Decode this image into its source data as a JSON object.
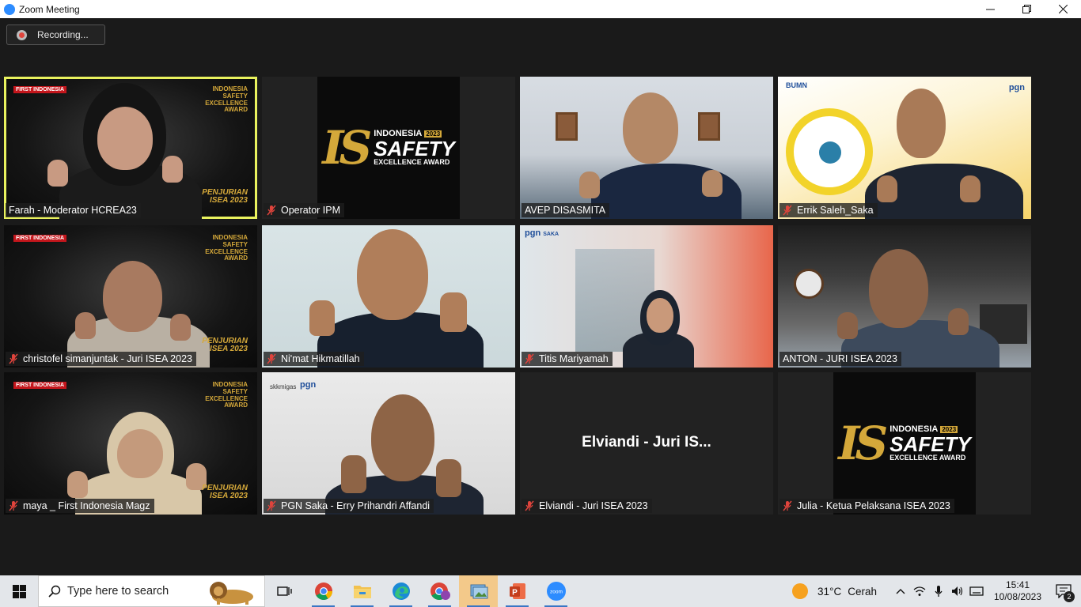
{
  "window": {
    "title": "Zoom Meeting"
  },
  "recording": {
    "label": "Recording..."
  },
  "tiles": [
    {
      "name": "Farah - Moderator HCREA23",
      "muted": false
    },
    {
      "name": "Operator IPM",
      "muted": true
    },
    {
      "name": "AVEP DISASMITA",
      "muted": false
    },
    {
      "name": "Errik Saleh_Saka",
      "muted": true
    },
    {
      "name": "christofel simanjuntak - Juri ISEA 2023",
      "muted": true
    },
    {
      "name": "Ni'mat Hikmatillah",
      "muted": true
    },
    {
      "name": "Titis Mariyamah",
      "muted": true
    },
    {
      "name": "ANTON - JURI ISEA 2023",
      "muted": false
    },
    {
      "name": "maya _ First Indonesia Magz",
      "muted": true
    },
    {
      "name": "PGN Saka - Erry Prihandri Affandi",
      "muted": true
    },
    {
      "name": "Elviandi -  Juri ISEA 2023",
      "muted": true,
      "display_name": "Elviandi -  Juri IS..."
    },
    {
      "name": "Julia - Ketua Pelaksana ISEA 2023",
      "muted": true
    }
  ],
  "isea_logo": {
    "line1": "INDONESIA",
    "year": "2023",
    "line2": "SAFETY",
    "line3": "EXCELLENCE AWARD",
    "mark": "IS"
  },
  "overlay": {
    "brand": "FIRST INDONESIA",
    "isea_small": "INDONESIA SAFETY EXCELLENCE AWARD",
    "penjurian": "PENJURIAN",
    "isea_year": "ISEA 2023"
  },
  "logos": {
    "pgn": "pgn",
    "saka": "SAKA",
    "skkmigas": "skkmigas",
    "bumn": "BUMN"
  },
  "taskbar": {
    "search_placeholder": "Type here to search",
    "apps": [
      "task-view",
      "chrome",
      "file-explorer",
      "edge",
      "chrome-profile",
      "photos",
      "powerpoint",
      "zoom"
    ],
    "weather_temp": "31°C",
    "weather_cond": "Cerah",
    "time": "15:41",
    "date": "10/08/2023",
    "notifications": "2"
  },
  "colors": {
    "active_speaker": "#e9f25e",
    "muted_icon": "#e0443c",
    "accent_gold": "#d4a83a",
    "zoom_blue": "#2d8cff"
  }
}
